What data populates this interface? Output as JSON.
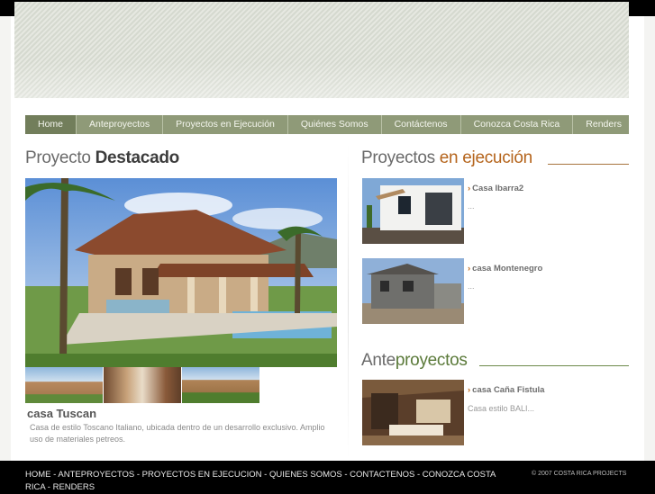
{
  "nav": {
    "items": [
      {
        "label": "Home",
        "active": true
      },
      {
        "label": "Anteproyectos"
      },
      {
        "label": "Proyectos en Ejecución"
      },
      {
        "label": "Quiénes Somos"
      },
      {
        "label": "Contáctenos"
      },
      {
        "label": "Conozca Costa Rica"
      },
      {
        "label": "Renders"
      }
    ]
  },
  "featured": {
    "title_light": "Proyecto ",
    "title_bold": "Destacado",
    "name": "casa Tuscan",
    "description": "Casa de estilo Toscano Italiano, ubicada dentro de un desarrollo exclusivo. Amplio uso de materiales petreos."
  },
  "ejecucion": {
    "title_light": "Proyectos ",
    "title_bold": "en ejecución",
    "items": [
      {
        "name": "Casa Ibarra2",
        "sub": "..."
      },
      {
        "name": "casa Montenegro",
        "sub": "..."
      }
    ]
  },
  "ante": {
    "title_light": "Ante",
    "title_bold": "proyectos",
    "items": [
      {
        "name": "casa Caña Fistula",
        "sub": "Casa estilo BALI..."
      }
    ]
  },
  "footer": {
    "links": "HOME - ANTEPROYECTOS - PROYECTOS EN EJECUCION - QUIENES SOMOS - CONTACTENOS - CONOZCA COSTA RICA - RENDERS",
    "copyright": "© 2007 COSTA RICA PROJECTS"
  },
  "colors": {
    "nav_bg": "#8f9a78",
    "accent_orange": "#b5651d",
    "accent_green": "#5b7a3a"
  }
}
